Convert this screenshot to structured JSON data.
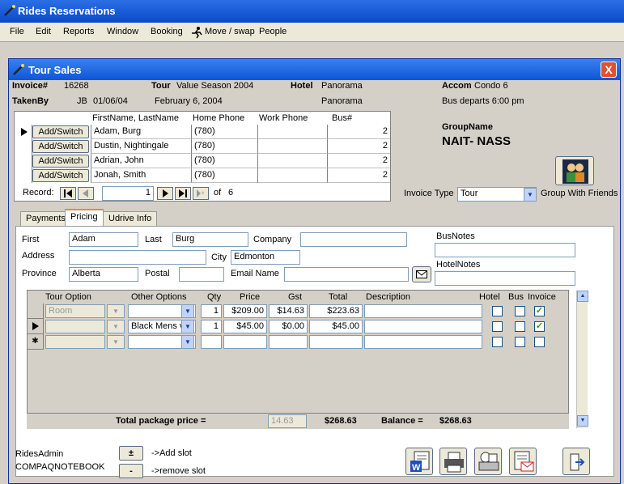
{
  "app": {
    "title": "Rides Reservations"
  },
  "menu": [
    "File",
    "Edit",
    "Reports",
    "Window",
    "Booking",
    "Move / swap",
    "People"
  ],
  "window": {
    "title": "Tour Sales",
    "close": "X"
  },
  "header": {
    "invoice_label": "Invoice#",
    "invoice": "16268",
    "tour_label": "Tour",
    "tour": "Value Season 2004",
    "hotel_label": "Hotel",
    "hotel": "Panorama",
    "hotel2": "Panorama",
    "accom_label": "Accom",
    "accom": "Condo 6",
    "bus_departs": "Bus departs 6:00 pm",
    "takenby_label": "TakenBy",
    "takenby": "JB",
    "taken_date": "01/06/04",
    "tour_date": "February 6, 2004",
    "groupname_label": "GroupName",
    "groupname": "NAIT- NASS",
    "invoice_type_label": "Invoice Type",
    "invoice_type": "Tour",
    "group_with_friends": "Group With Friends"
  },
  "passengers": {
    "columns": [
      "FirstName, LastName",
      "Home Phone",
      "Work Phone",
      "Bus#"
    ],
    "button_label": "Add/Switch",
    "rows": [
      {
        "name": "Adam, Burg",
        "home": "(780)",
        "work": "",
        "bus": "2"
      },
      {
        "name": "Dustin, Nightingale",
        "home": "(780)",
        "work": "",
        "bus": "2"
      },
      {
        "name": "Adrian, John",
        "home": "(780)",
        "work": "",
        "bus": "2"
      },
      {
        "name": "Jonah, Smith",
        "home": "(780)",
        "work": "",
        "bus": "2"
      }
    ],
    "record_label": "Record:",
    "record": "1",
    "of_label": "of",
    "total": "6"
  },
  "tabs": [
    "Payments",
    "Pricing",
    "Udrive Info"
  ],
  "person": {
    "first_label": "First",
    "first": "Adam",
    "last_label": "Last",
    "last": "Burg",
    "company_label": "Company",
    "company": "",
    "address_label": "Address",
    "address": "",
    "city_label": "City",
    "city": "Edmonton",
    "province_label": "Province",
    "province": "Alberta",
    "postal_label": "Postal",
    "postal": "",
    "email_label": "Email Name",
    "email": "",
    "busnotes_label": "BusNotes",
    "busnotes": "",
    "hotelnotes_label": "HotelNotes",
    "hotelnotes": ""
  },
  "options": {
    "columns": [
      "Tour Option",
      "Other Options",
      "Qty",
      "Price",
      "Gst",
      "Total",
      "Description",
      "Hotel",
      "Bus",
      "Invoice"
    ],
    "rows": [
      {
        "tour_option": "Room",
        "other": "",
        "qty": "1",
        "price": "$209.00",
        "gst": "$14.63",
        "total": "$223.63",
        "desc": "",
        "hotel": false,
        "bus": false,
        "invoice": true
      },
      {
        "tour_option": "",
        "other": "Black Mens v",
        "qty": "1",
        "price": "$45.00",
        "gst": "$0.00",
        "total": "$45.00",
        "desc": "",
        "hotel": false,
        "bus": false,
        "invoice": true
      }
    ],
    "new_row_marker": "✱"
  },
  "summary": {
    "total_label": "Total package price =",
    "gst_total": "14.63",
    "total": "$268.63",
    "balance_label": "Balance =",
    "balance": "$268.63"
  },
  "footer": {
    "user": "RidesAdmin",
    "computer": "COMPAQNOTEBOOK",
    "add_btn": "±",
    "add_label": "->Add slot",
    "remove_btn": "-",
    "remove_label": "->remove slot"
  }
}
